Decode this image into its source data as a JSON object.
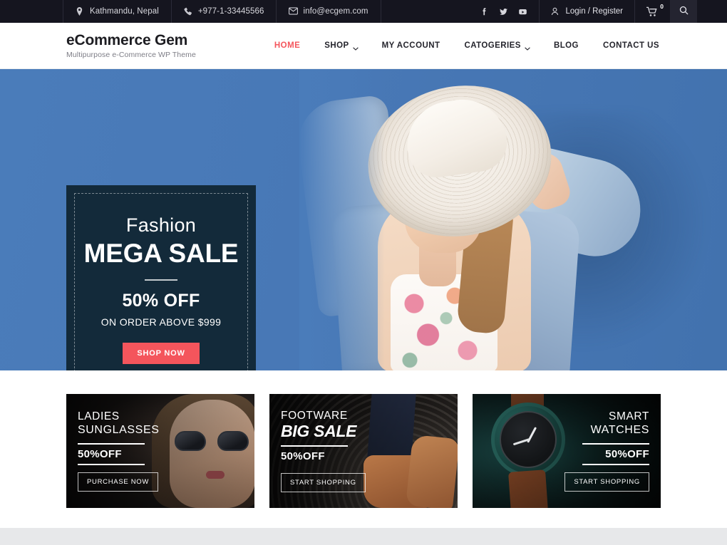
{
  "topbar": {
    "location": "Kathmandu, Nepal",
    "phone": "+977-1-33445566",
    "email": "info@ecgem.com",
    "social": [
      {
        "name": "facebook-icon",
        "label": "f"
      },
      {
        "name": "twitter-icon",
        "label": "t"
      },
      {
        "name": "youtube-icon",
        "label": "y"
      }
    ],
    "login_label": "Login / Register",
    "cart_count": "0"
  },
  "brand": {
    "title": "eCommerce Gem",
    "tagline": "Multipurpose e-Commerce WP Theme"
  },
  "nav": {
    "items": [
      {
        "label": "HOME",
        "active": true,
        "dropdown": false
      },
      {
        "label": "SHOP",
        "active": false,
        "dropdown": true
      },
      {
        "label": "MY ACCOUNT",
        "active": false,
        "dropdown": false
      },
      {
        "label": "CATOGERIES",
        "active": false,
        "dropdown": true
      },
      {
        "label": "BLOG",
        "active": false,
        "dropdown": false
      },
      {
        "label": "CONTACT US",
        "active": false,
        "dropdown": false
      }
    ]
  },
  "hero": {
    "eyebrow": "Fashion",
    "headline": "MEGA SALE",
    "discount": "50% OFF",
    "condition": "ON ORDER ABOVE $999",
    "cta": "SHOP NOW",
    "slide_count": 4,
    "active_slide": 1
  },
  "promos": [
    {
      "title_line1": "LADIES",
      "title_line2": "SUNGLASSES",
      "offer": "50%OFF",
      "cta": "PURCHASE NOW",
      "align": "left"
    },
    {
      "title_line1": "FOOTWARE",
      "title_line2": "BIG SALE",
      "offer": "50%OFF",
      "cta": "START SHOPPING",
      "align": "left"
    },
    {
      "title_line1": "SMART",
      "title_line2": "WATCHES",
      "offer": "50%OFF",
      "cta": "START SHOPPING",
      "align": "right"
    }
  ],
  "colors": {
    "accent": "#f4555c",
    "topbar_bg": "#15151f",
    "hero_bg": "#4a7cba",
    "hero_panel": "#132a3a",
    "bottom_band": "#e7e8ea"
  }
}
